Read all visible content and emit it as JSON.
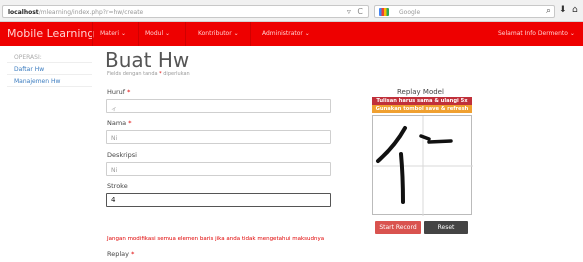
{
  "browser": {
    "url_host": "localhost",
    "url_path": "/mlearning/index.php?r=hw/create",
    "search_placeholder": "Google",
    "icons": [
      "reload-icon",
      "search-icon",
      "download-icon",
      "home-icon"
    ]
  },
  "navbar": {
    "brand": "Mobile Learning",
    "items": [
      {
        "label": "Materi ⌄"
      },
      {
        "label": "Modul ⌄"
      },
      {
        "label": "Kontributor ⌄"
      },
      {
        "label": "Administrator ⌄"
      }
    ],
    "user": "Selamat Info Dermento ⌄",
    "color": "#ee0000"
  },
  "sidebar": {
    "heading": "OPERASI:",
    "items": [
      {
        "label": "Daftar Hw"
      },
      {
        "label": "Manajemen Hw"
      }
    ]
  },
  "form": {
    "title": "Buat Hw",
    "note_prefix": "Fields dengan tanda ",
    "note_star": "*",
    "note_suffix": " diperlukan",
    "fields": [
      {
        "label": "Huruf",
        "required": "*",
        "value": "ィ"
      },
      {
        "label": "Nama",
        "required": "*",
        "value": "Ni"
      },
      {
        "label": "Deskripsi",
        "required": "",
        "value": "Ni"
      },
      {
        "label": "Stroke",
        "required": "",
        "value": "4"
      }
    ],
    "warning": "Jangan modifikasi semua elemen baris jika anda tidak mengetahui maksudnya",
    "replay_label": "Replay",
    "replay_required": "*"
  },
  "replay_model": {
    "title": "Replay Model",
    "notice_1": "Tulisan harus sama & ulangi 5x",
    "notice_2": "Gunakan tombol save & refresh",
    "start_button": "Start Record",
    "reset_button": "Reset"
  }
}
